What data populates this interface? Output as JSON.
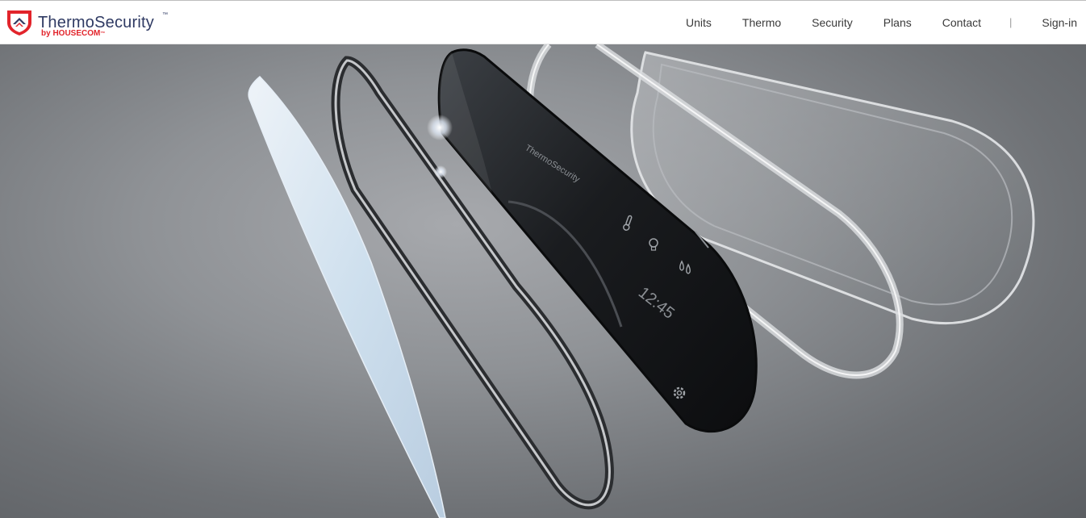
{
  "brand": {
    "name": "ThermoSecurity",
    "trademark": "™",
    "byline": "by HOUSECOM",
    "byline_trademark": "™",
    "colors": {
      "navy": "#2f3a63",
      "red": "#e2242b"
    }
  },
  "nav": {
    "items": [
      {
        "label": "Units"
      },
      {
        "label": "Thermo"
      },
      {
        "label": "Security"
      },
      {
        "label": "Plans"
      },
      {
        "label": "Contact"
      }
    ],
    "separator": "|",
    "signin": "Sign-in"
  },
  "hero": {
    "device_brand": "ThermoSecurity",
    "device_time": "12:45",
    "icons": [
      "thermometer-icon",
      "lightbulb-icon",
      "droplets-icon",
      "gear-icon"
    ]
  }
}
